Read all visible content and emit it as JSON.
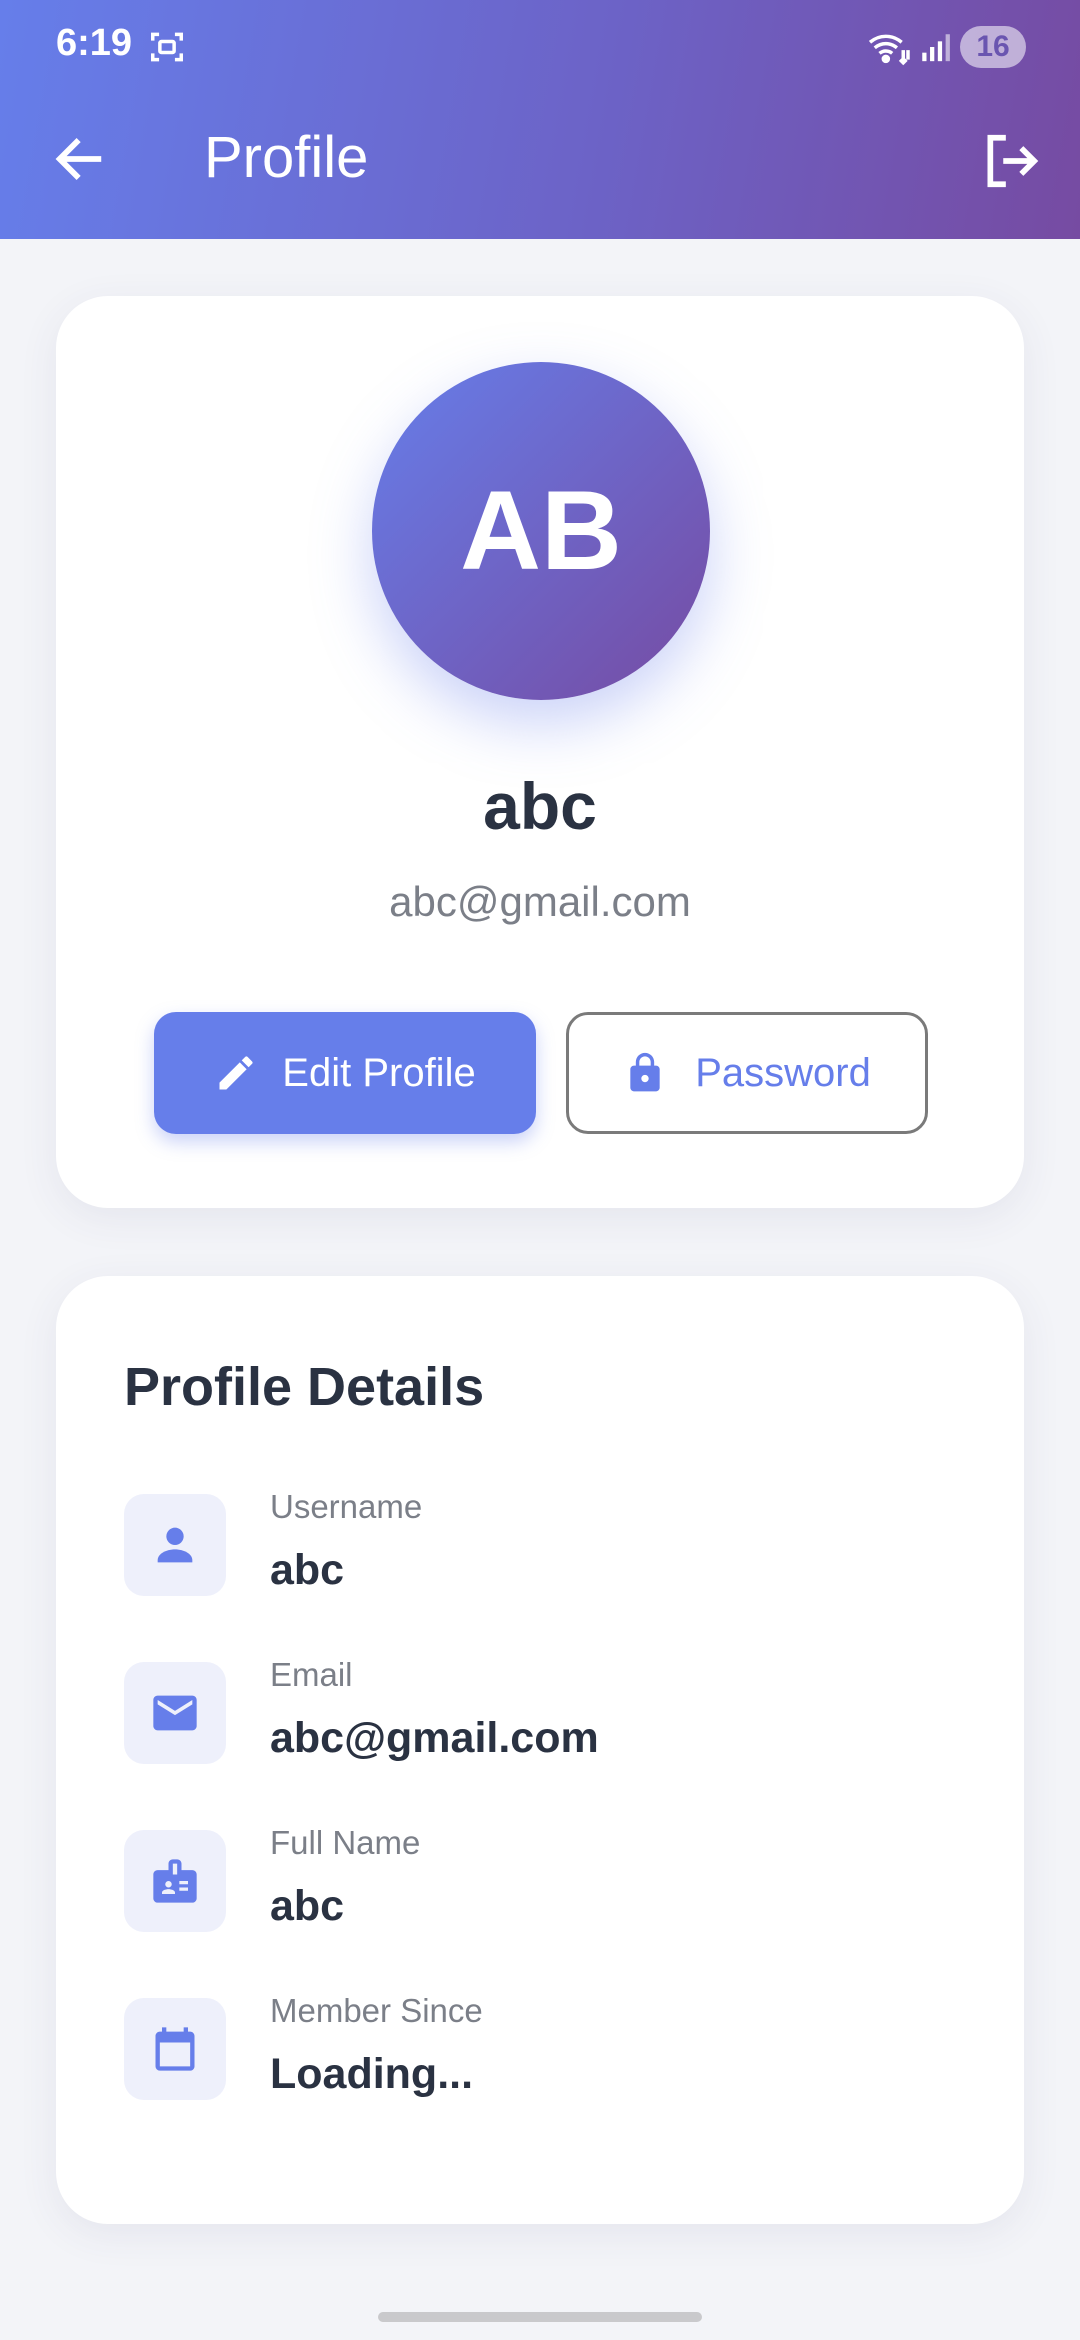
{
  "status_bar": {
    "time": "6:19",
    "battery": "16"
  },
  "header": {
    "title": "Profile",
    "icons": [
      "back-arrow-icon",
      "logout-icon"
    ]
  },
  "profile": {
    "initials": "AB",
    "name": "abc",
    "email": "abc@gmail.com",
    "edit_label": "Edit Profile",
    "password_label": "Password"
  },
  "details": {
    "title": "Profile Details",
    "rows": [
      {
        "label": "Username",
        "value": "abc",
        "icon": "person-icon"
      },
      {
        "label": "Email",
        "value": "abc@gmail.com",
        "icon": "mail-icon"
      },
      {
        "label": "Full Name",
        "value": "abc",
        "icon": "badge-icon"
      },
      {
        "label": "Member Since",
        "value": "Loading...",
        "icon": "calendar-icon"
      }
    ]
  },
  "colors": {
    "accent": "#667eea",
    "gradient_end": "#764ba2",
    "background": "#f3f4f8",
    "text_dark": "#2a3242",
    "text_muted": "#7b7f88"
  }
}
